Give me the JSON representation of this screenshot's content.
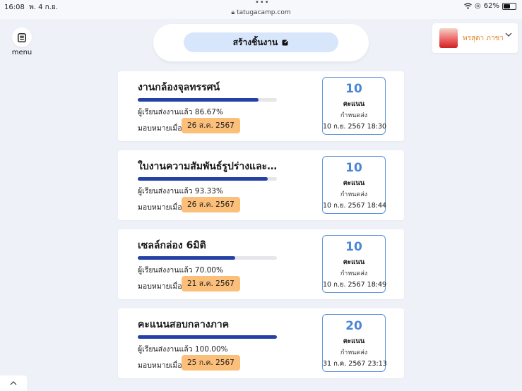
{
  "status_bar": {
    "time": "16:08",
    "date": "พ. 4 ก.ย.",
    "dots": "•••",
    "url": "tatugacamp.com",
    "battery": "62%",
    "battery_level": 0.62
  },
  "header": {
    "menu_label": "menu",
    "create_button_label": "สร้างชิ้นงาน",
    "user_name": "พรสุดา ภาชา"
  },
  "assignments": [
    {
      "title": "งานกล้องจุลทรรศน์",
      "sent_text": "ผู้เรียนส่งงานแล้ว 86.67%",
      "progress": 0.8667,
      "assigned_label": "มอบหมายเมื่อ",
      "assigned_date": "26 ส.ค. 2567",
      "score": "10",
      "score_unit": "คะแนน",
      "due_label": "กำหนดส่ง",
      "due_date": "10 ก.ย. 2567 18:30"
    },
    {
      "title": "ใบงานความสัมพันธ์รูปร่างและหน้าที่",
      "sent_text": "ผู้เรียนส่งงานแล้ว 93.33%",
      "progress": 0.9333,
      "assigned_label": "มอบหมายเมื่อ",
      "assigned_date": "26 ส.ค. 2567",
      "score": "10",
      "score_unit": "คะแนน",
      "due_label": "กำหนดส่ง",
      "due_date": "10 ก.ย. 2567 18:44"
    },
    {
      "title": "เซลล์กล่อง 6มิติ",
      "sent_text": "ผู้เรียนส่งงานแล้ว 70.00%",
      "progress": 0.7,
      "assigned_label": "มอบหมายเมื่อ",
      "assigned_date": "21 ส.ค. 2567",
      "score": "10",
      "score_unit": "คะแนน",
      "due_label": "กำหนดส่ง",
      "due_date": "10 ก.ย. 2567 18:49"
    },
    {
      "title": "คะแนนสอบกลางภาค",
      "sent_text": "ผู้เรียนส่งงานแล้ว 100.00%",
      "progress": 1.0,
      "assigned_label": "มอบหมายเมื่อ",
      "assigned_date": "25 ก.ค. 2567",
      "score": "20",
      "score_unit": "คะแนน",
      "due_label": "กำหนดส่ง",
      "due_date": "31 ก.ค. 2567 23:13"
    }
  ],
  "colors": {
    "progress_fill": "#2541a6",
    "badge": "#fbbf7a",
    "score_accent": "#4a86d6",
    "user_name": "#e08a2a"
  }
}
